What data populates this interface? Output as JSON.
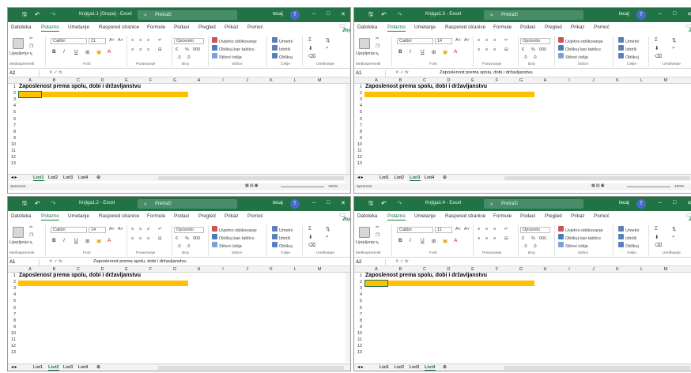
{
  "windows": [
    {
      "id": "w1",
      "title": "Knjiga1:1 [Grupa] - Excel",
      "search_label": "Pretraži",
      "user": "tecaj",
      "avatar_initial": "T",
      "menu": [
        "Datoteka",
        "Polazno",
        "Umetanje",
        "Raspored stranice",
        "Formule",
        "Podaci",
        "Pregled",
        "Prikaz",
        "Pomoć"
      ],
      "share": "Zajedničko korištenje",
      "font_name": "Calibri",
      "font_size": "11",
      "number_format": "Općenito",
      "cond_format": "Uvjetno oblikovanje",
      "format_table": "Oblikuj kao tablicu",
      "cell_styles": "Stilovi ćelija",
      "insert": "Umetni",
      "delete": "Izbriši",
      "format": "Oblikuj",
      "paste_label": "Lijepljenje",
      "group_labels": [
        "Međuspremnik",
        "Font",
        "Poravnanje",
        "Broj",
        "Stilovi",
        "Ćelije",
        "Uređivanje"
      ],
      "name_box": "A2",
      "formula": "",
      "cols": [
        "A",
        "B",
        "C",
        "D",
        "E",
        "F",
        "G",
        "H",
        "I",
        "J",
        "K",
        "L",
        "M"
      ],
      "rows": [
        "1",
        "2",
        "3",
        "4",
        "5",
        "6",
        "7",
        "8",
        "9",
        "10",
        "11",
        "12",
        "13"
      ],
      "cell_a1": "Zaposlenost prema spolu, dobi i državljanstvu",
      "sheets": [
        "List1",
        "List2",
        "List3",
        "List4"
      ],
      "active_sheet": 0,
      "status_left": "Spreman",
      "zoom": "100%"
    },
    {
      "id": "w2",
      "title": "Knjiga1:3 - Excel",
      "search_label": "Pretraži",
      "user": "tecaj",
      "avatar_initial": "T",
      "menu": [
        "Datoteka",
        "Polazno",
        "Umetanje",
        "Raspored stranice",
        "Formule",
        "Podaci",
        "Pregled",
        "Prikaz",
        "Pomoć"
      ],
      "share": "Zajedničko korištenje",
      "font_name": "Calibri",
      "font_size": "14",
      "number_format": "Općenito",
      "cond_format": "Uvjetno oblikovanje",
      "format_table": "Oblikuj kao tablicu",
      "cell_styles": "Stilovi ćelija",
      "insert": "Umetni",
      "delete": "Izbriši",
      "format": "Oblikuj",
      "paste_label": "Lijepljenje",
      "group_labels": [
        "Međuspremnik",
        "Font",
        "Poravnanje",
        "Broj",
        "Stilovi",
        "Ćelije",
        "Uređivanje"
      ],
      "name_box": "A1",
      "formula": "Zaposlenost prema spolu, dobi i državljanstvu",
      "cols": [
        "A",
        "B",
        "C",
        "D",
        "E",
        "F",
        "G",
        "H",
        "I",
        "J",
        "K",
        "L",
        "M"
      ],
      "rows": [
        "1",
        "2",
        "3",
        "4",
        "5",
        "6",
        "7",
        "8",
        "9",
        "10",
        "11",
        "12",
        "13"
      ],
      "cell_a1": "Zaposlenost prema spolu, dobi i državljanstvu",
      "sheets": [
        "List1",
        "List2",
        "List3",
        "List4"
      ],
      "active_sheet": 2,
      "status_left": "Spreman",
      "zoom": "100%"
    },
    {
      "id": "w3",
      "title": "Knjiga1:2 - Excel",
      "search_label": "Pretraži",
      "user": "tecaj",
      "avatar_initial": "T",
      "menu": [
        "Datoteka",
        "Polazno",
        "Umetanje",
        "Raspored stranice",
        "Formule",
        "Podaci",
        "Pregled",
        "Prikaz",
        "Pomoć"
      ],
      "share": "Zajedničko korištenje",
      "font_name": "Calibri",
      "font_size": "14",
      "number_format": "Općenito",
      "cond_format": "Uvjetno oblikovanje",
      "format_table": "Oblikuj kao tablicu",
      "cell_styles": "Stilovi ćelija",
      "insert": "Umetni",
      "delete": "Izbriši",
      "format": "Oblikuj",
      "paste_label": "Lijepljenje",
      "group_labels": [
        "Međuspremnik",
        "Font",
        "Poravnanje",
        "Broj",
        "Stilovi",
        "Ćelije",
        "Uređivanje"
      ],
      "name_box": "A1",
      "formula": "Zaposlenost prema spolu, dobi i državljanstvu",
      "cols": [
        "A",
        "B",
        "C",
        "D",
        "E",
        "F",
        "G",
        "H",
        "I",
        "J",
        "K",
        "L",
        "M"
      ],
      "rows": [
        "1",
        "2",
        "3",
        "4",
        "5",
        "6",
        "7",
        "8",
        "9",
        "10",
        "11",
        "12",
        "13"
      ],
      "cell_a1": "Zaposlenost prema spolu, dobi i državljanstvu",
      "sheets": [
        "List1",
        "List2",
        "List3",
        "List4"
      ],
      "active_sheet": 1,
      "status_left": "",
      "zoom": ""
    },
    {
      "id": "w4",
      "title": "Knjiga1:4 - Excel",
      "search_label": "Pretraži",
      "user": "tecaj",
      "avatar_initial": "T",
      "menu": [
        "Datoteka",
        "Polazno",
        "Umetanje",
        "Raspored stranice",
        "Formule",
        "Podaci",
        "Pregled",
        "Prikaz",
        "Pomoć"
      ],
      "share": "Zajedničko korištenje",
      "font_name": "Calibri",
      "font_size": "11",
      "number_format": "Općenito",
      "cond_format": "Uvjetno oblikovanje",
      "format_table": "Oblikuj kao tablicu",
      "cell_styles": "Stilovi ćelija",
      "insert": "Umetni",
      "delete": "Izbriši",
      "format": "Oblikuj",
      "paste_label": "Lijepljenje",
      "group_labels": [
        "Međuspremnik",
        "Font",
        "Poravnanje",
        "Broj",
        "Stilovi",
        "Ćelije",
        "Uređivanje"
      ],
      "name_box": "A2",
      "formula": "",
      "cols": [
        "A",
        "B",
        "C",
        "D",
        "E",
        "F",
        "G",
        "H",
        "I",
        "J",
        "K",
        "L",
        "M"
      ],
      "rows": [
        "1",
        "2",
        "3",
        "4",
        "5",
        "6",
        "7",
        "8",
        "9",
        "10",
        "11",
        "12",
        "13"
      ],
      "cell_a1": "Zaposlenost prema spolu, dobi i državljanstvu",
      "sheets": [
        "List1",
        "List2",
        "List3",
        "List4"
      ],
      "active_sheet": 3,
      "status_left": "",
      "zoom": ""
    }
  ],
  "colors": {
    "titlebar": "#217346",
    "highlight": "#ffc000",
    "accent": "#217346"
  }
}
